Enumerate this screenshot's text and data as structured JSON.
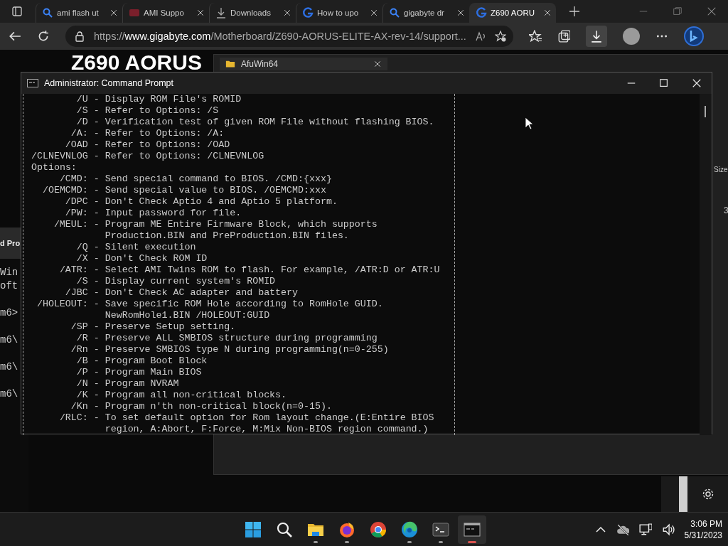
{
  "browser": {
    "tabs": [
      {
        "kind": "search",
        "label": "ami flash ut",
        "selected": false
      },
      {
        "kind": "site",
        "label": "AMI Suppo",
        "selected": false
      },
      {
        "kind": "download",
        "label": "Downloads",
        "selected": false
      },
      {
        "kind": "logo",
        "label": "How to upo",
        "selected": false
      },
      {
        "kind": "search",
        "label": "gigabyte dr",
        "selected": false
      },
      {
        "kind": "logo",
        "label": "Z690 AORU",
        "selected": true
      }
    ],
    "url": "https://**www.gigabyte.com**/Motherboard/Z690-AORUS-ELITE-AX-rev-14/support...",
    "page_heading": "Z690 AORUS"
  },
  "explorer": {
    "tab_label": "AfuWin64",
    "column_header": "Size",
    "cell": "3"
  },
  "background_console": {
    "title": "d Pro",
    "lines": [
      "Win",
      "oft",
      "m6>",
      "m6\\",
      "m6\\",
      "m6\\"
    ]
  },
  "console": {
    "title": "Administrator: Command Prompt",
    "lines": [
      {
        "kind": "option",
        "flag": "/U",
        "text": "- Display ROM File's ROMID"
      },
      {
        "kind": "option",
        "flag": "/S",
        "text": "- Refer to Options: /S"
      },
      {
        "kind": "option",
        "flag": "/D",
        "text": "- Verification test of given ROM File without flashing BIOS."
      },
      {
        "kind": "option",
        "flag": "/A:",
        "text": "- Refer to Options: /A:"
      },
      {
        "kind": "option",
        "flag": "/OAD",
        "text": "- Refer to Options: /OAD"
      },
      {
        "kind": "option",
        "flag": "/CLNEVNLOG",
        "text": "- Refer to Options: /CLNEVNLOG"
      },
      {
        "kind": "heading",
        "text": "Options:"
      },
      {
        "kind": "option",
        "flag": "/CMD:",
        "text": "- Send special command to BIOS. /CMD:{xxx}"
      },
      {
        "kind": "option",
        "flag": "/OEMCMD:",
        "text": "- Send special value to BIOS. /OEMCMD:xxx"
      },
      {
        "kind": "option",
        "flag": "/DPC",
        "text": "- Don't Check Aptio 4 and Aptio 5 platform."
      },
      {
        "kind": "option",
        "flag": "/PW:",
        "text": "- Input password for file."
      },
      {
        "kind": "option",
        "flag": "/MEUL:",
        "text": "- Program ME Entire Firmware Block, which supports"
      },
      {
        "kind": "continuation",
        "text": "Production.BIN and PreProduction.BIN files."
      },
      {
        "kind": "option",
        "flag": "/Q",
        "text": "- Silent execution"
      },
      {
        "kind": "option",
        "flag": "/X",
        "text": "- Don't Check ROM ID"
      },
      {
        "kind": "option",
        "flag": "/ATR:",
        "text": "- Select AMI Twins ROM to flash. For example, /ATR:D or ATR:U"
      },
      {
        "kind": "option",
        "flag": "/S",
        "text": "- Display current system's ROMID"
      },
      {
        "kind": "option",
        "flag": "/JBC",
        "text": "- Don't Check AC adapter and battery"
      },
      {
        "kind": "option",
        "flag": "/HOLEOUT:",
        "text": "- Save specific ROM Hole according to RomHole GUID."
      },
      {
        "kind": "continuation",
        "text": "NewRomHole1.BIN /HOLEOUT:GUID"
      },
      {
        "kind": "option",
        "flag": "/SP",
        "text": "- Preserve Setup setting."
      },
      {
        "kind": "option",
        "flag": "/R",
        "text": "- Preserve ALL SMBIOS structure during programming"
      },
      {
        "kind": "option",
        "flag": "/Rn",
        "text": "- Preserve SMBIOS type N during programming(n=0-255)"
      },
      {
        "kind": "option",
        "flag": "/B",
        "text": "- Program Boot Block"
      },
      {
        "kind": "option",
        "flag": "/P",
        "text": "- Program Main BIOS"
      },
      {
        "kind": "option",
        "flag": "/N",
        "text": "- Program NVRAM"
      },
      {
        "kind": "option",
        "flag": "/K",
        "text": "- Program all non-critical blocks."
      },
      {
        "kind": "option",
        "flag": "/Kn",
        "text": "- Program n'th non-critical block(n=0-15)."
      },
      {
        "kind": "option",
        "flag": "/RLC:",
        "text": "- To set default option for Rom layout change.(E:Entire BIOS"
      },
      {
        "kind": "continuation",
        "text": "region, A:Abort, F:Force, M:Mix Non-BIOS region command.)"
      }
    ]
  },
  "taskbar": {
    "apps": [
      {
        "kind": "start",
        "running": false,
        "selected": false
      },
      {
        "kind": "search",
        "running": false,
        "selected": false
      },
      {
        "kind": "explorer",
        "running": true,
        "selected": false
      },
      {
        "kind": "firefox",
        "running": true,
        "selected": false
      },
      {
        "kind": "chrome",
        "running": false,
        "selected": false
      },
      {
        "kind": "edge",
        "running": true,
        "selected": false
      },
      {
        "kind": "terminal",
        "running": true,
        "selected": false
      },
      {
        "kind": "console",
        "running": true,
        "selected": true
      }
    ],
    "time": "3:06 PM",
    "date": "5/31/2023"
  }
}
